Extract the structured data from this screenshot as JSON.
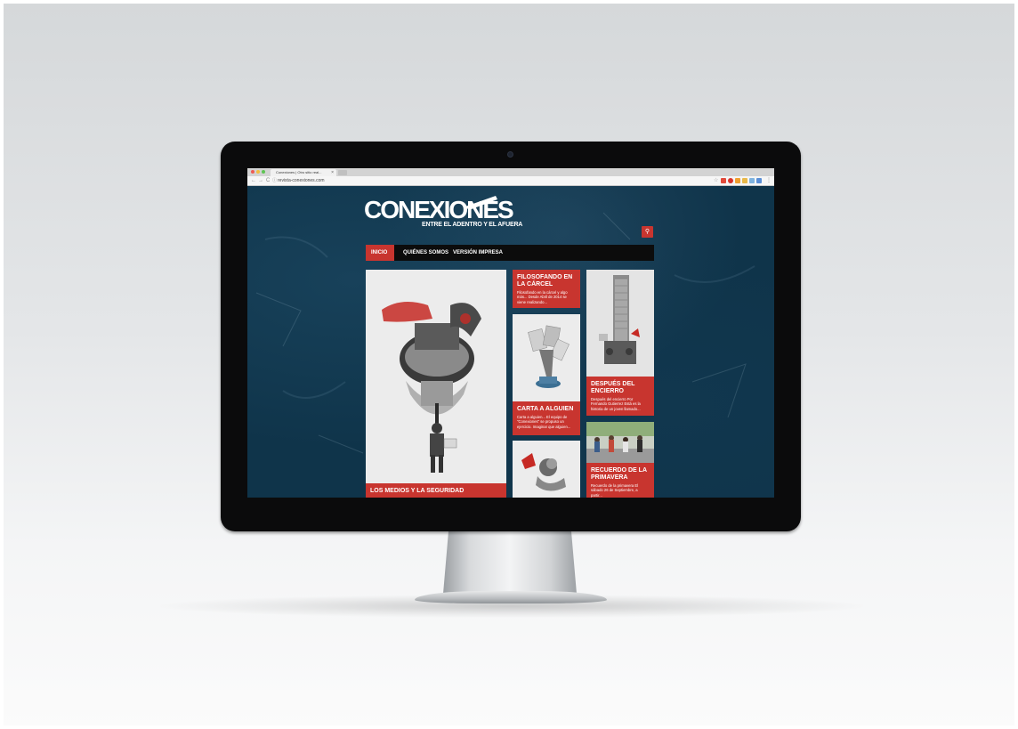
{
  "browser": {
    "tab_title": "Conexiones | Otro sitio real...",
    "tab_close": "×",
    "url": "revista-conexiones.com",
    "nav_back": "←",
    "nav_forward": "→",
    "nav_reload": "C",
    "menu": "⋮"
  },
  "site": {
    "logo": {
      "main": "CONEXIONES",
      "sub": "ENTRE EL ADENTRO Y EL AFUERA"
    },
    "search_icon": "search-icon",
    "nav": [
      {
        "label": "INICIO",
        "active": true
      },
      {
        "label": "QUIÉNES SOMOS",
        "active": false
      },
      {
        "label": "VERSIÓN IMPRESA",
        "active": false
      }
    ],
    "cards": {
      "featured": {
        "title": "LOS MEDIOS Y LA SEGURIDAD"
      },
      "filosofando": {
        "title": "FILOSOFANDO EN LA CÁRCEL",
        "excerpt": "Filosofando en la cárcel y algo más... Desde Abril de 2014 se viene realizando..."
      },
      "carta": {
        "title": "CARTA A ALGUIEN",
        "excerpt": "Carta a alguien... El equipo de \"Conexiones\" se propuso un ejercicio. Imaginar que alguien..."
      },
      "despues": {
        "title": "DESPUÉS DEL ENCIERRO",
        "excerpt": "Después del encierro Por Fernando Gutierrez Está es la historia de un joven llamado..."
      },
      "recuerdo": {
        "title": "RECUERDO DE LA PRIMAVERA",
        "excerpt": "Recuerdo de la primavera El sábado 26 de Septiembre, a partir..."
      }
    }
  },
  "colors": {
    "accent": "#c8352f",
    "background": "#0f344a",
    "navbar": "#0c0c0c"
  }
}
